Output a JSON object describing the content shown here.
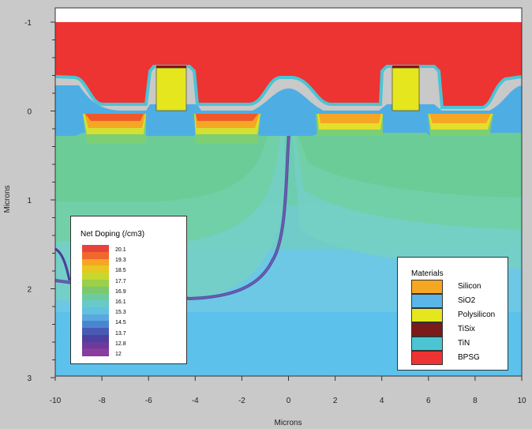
{
  "chart_data": {
    "type": "heatmap",
    "xlabel": "Microns",
    "ylabel": "Microns",
    "xlim": [
      -10,
      10
    ],
    "ylim": [
      -1,
      3
    ],
    "x_ticks": [
      "-10",
      "-8",
      "-6",
      "-4",
      "-2",
      "0",
      "2",
      "4",
      "6",
      "8",
      "10"
    ],
    "y_ticks": [
      "-1",
      "0",
      "1",
      "2",
      "3"
    ],
    "doping_legend": {
      "title": "Net Doping (/cm3)",
      "labels": [
        "20.1",
        "19.3",
        "18.5",
        "17.7",
        "16.9",
        "16.1",
        "15.3",
        "14.5",
        "13.7",
        "12.8",
        "12"
      ]
    },
    "materials_legend": {
      "title": "Materials",
      "items": [
        {
          "name": "Silicon",
          "color": "#f5a623"
        },
        {
          "name": "SiO2",
          "color": "#5ab6e6"
        },
        {
          "name": "Polysilicon",
          "color": "#e6e61e"
        },
        {
          "name": "TiSix",
          "color": "#7a1a1a"
        },
        {
          "name": "TiN",
          "color": "#4cc4d4"
        },
        {
          "name": "BPSG",
          "color": "#ee3333"
        }
      ]
    }
  }
}
